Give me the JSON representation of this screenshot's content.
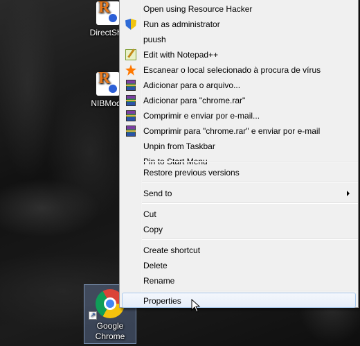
{
  "desktop": {
    "icons": [
      {
        "label": "DirectSho",
        "glyph": "R"
      },
      {
        "label": "NIBMods",
        "glyph": "R"
      },
      {
        "label_line1": "Google",
        "label_line2": "Chrome"
      }
    ]
  },
  "context_menu": {
    "items": [
      {
        "label": "Open using Resource Hacker",
        "icon": ""
      },
      {
        "label": "Run as administrator",
        "icon": "uac-shield-icon"
      },
      {
        "label": "puush",
        "icon": ""
      },
      {
        "label": "Edit with Notepad++",
        "icon": "notepad-plus-plus-icon"
      },
      {
        "label": "Escanear o local selecionado à procura de vírus",
        "icon": "avast-icon"
      },
      {
        "label": "Adicionar para o arquivo...",
        "icon": "winrar-icon"
      },
      {
        "label": "Adicionar para \"chrome.rar\"",
        "icon": "winrar-icon"
      },
      {
        "label": "Comprimir e enviar por e-mail...",
        "icon": "winrar-icon"
      },
      {
        "label": "Comprimir para \"chrome.rar\" e enviar por e-mail",
        "icon": "winrar-icon"
      },
      {
        "label": "Unpin from Taskbar",
        "icon": ""
      },
      {
        "label": "Pin to Start Menu",
        "icon": ""
      },
      {
        "label": "Restore previous versions",
        "icon": ""
      },
      {
        "label": "Send to",
        "icon": "",
        "submenu": true
      },
      {
        "label": "Cut",
        "icon": ""
      },
      {
        "label": "Copy",
        "icon": ""
      },
      {
        "label": "Create shortcut",
        "icon": ""
      },
      {
        "label": "Delete",
        "icon": ""
      },
      {
        "label": "Rename",
        "icon": ""
      },
      {
        "label": "Properties",
        "icon": "",
        "highlighted": true
      }
    ]
  },
  "colors": {
    "menu_background": "#f0f0f0",
    "highlight_border": "#a8c8ec",
    "selection_fill": "#7896c8"
  }
}
